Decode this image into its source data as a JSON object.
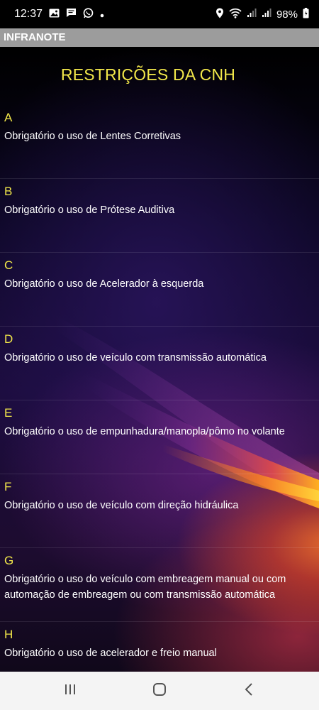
{
  "status_bar": {
    "time": "12:37",
    "battery": "98%",
    "icons_left": [
      "image-icon",
      "chat-icon",
      "whatsapp-icon",
      "dot-icon"
    ],
    "icons_right": [
      "location-icon",
      "wifi-icon",
      "signal-icon",
      "signal-icon",
      "battery-icon"
    ]
  },
  "app": {
    "title": "INFRANOTE"
  },
  "page": {
    "heading": "RESTRIÇÕES DA CNH"
  },
  "restrictions": [
    {
      "letter": "A",
      "description": "Obrigatório o uso de Lentes Corretivas"
    },
    {
      "letter": "B",
      "description": "Obrigatório o uso de Prótese Auditiva"
    },
    {
      "letter": "C",
      "description": "Obrigatório o uso de Acelerador à esquerda"
    },
    {
      "letter": "D",
      "description": "Obrigatório o uso de veículo com transmissão automática"
    },
    {
      "letter": "E",
      "description": "Obrigatório o uso de empunhadura/manopla/pômo no volante"
    },
    {
      "letter": "F",
      "description": "Obrigatório o uso de veículo com direção hidráulica"
    },
    {
      "letter": "G",
      "description": "Obrigatório o uso do veículo com embreagem manual ou com automação de embreagem ou com transmissão automática"
    },
    {
      "letter": "H",
      "description": "Obrigatório o uso de acelerador e freio manual"
    }
  ],
  "nav_bar": {
    "buttons": [
      "recents-icon",
      "home-icon",
      "back-icon"
    ]
  },
  "colors": {
    "accent_yellow": "#f3e84a",
    "app_bar": "#9c9c9c",
    "nav_bar": "#f4f4f4"
  }
}
